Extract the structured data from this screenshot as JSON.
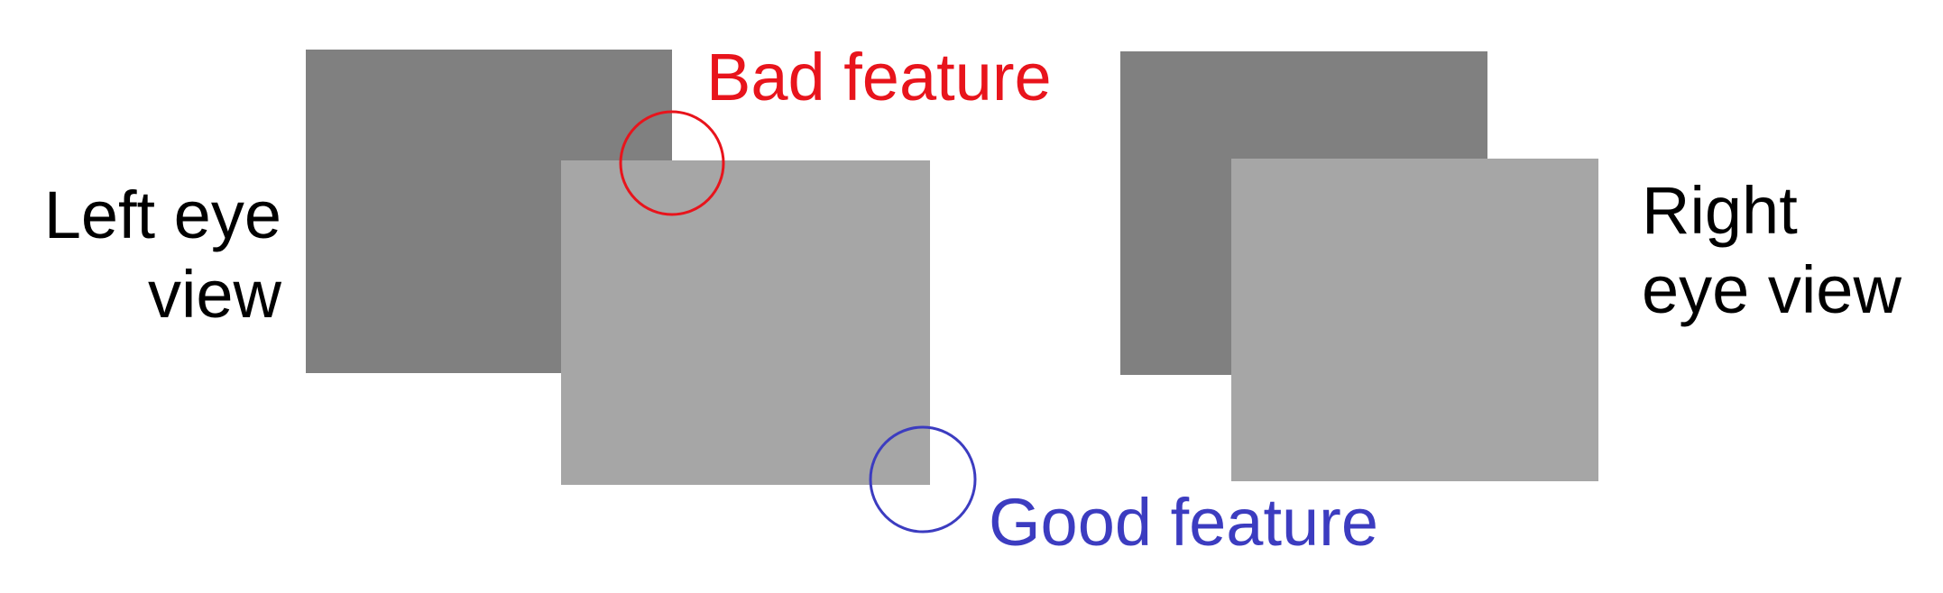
{
  "left_view": {
    "label_lines": [
      "Left eye",
      "view"
    ]
  },
  "right_view": {
    "label_lines": [
      "Right",
      "eye view"
    ]
  },
  "features": {
    "bad": {
      "label": "Bad feature",
      "color": "#e8141c"
    },
    "good": {
      "label": "Good feature",
      "color": "#3c3cc0"
    }
  },
  "colors": {
    "background_rect": "#808080",
    "foreground_rect": "#a6a6a6"
  }
}
